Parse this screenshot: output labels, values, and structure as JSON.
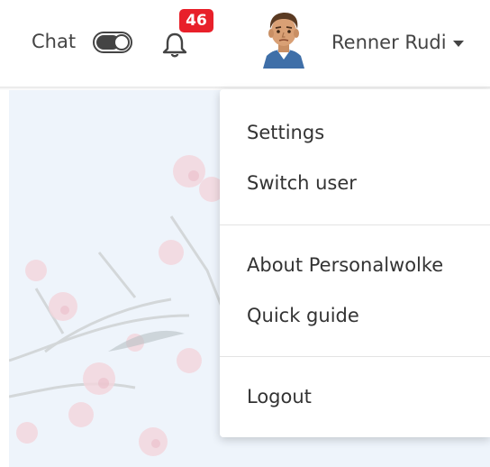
{
  "header": {
    "chat_label": "Chat",
    "chat_enabled": true,
    "notifications_count": "46",
    "user_name": "Renner Rudi"
  },
  "icons": {
    "chat_toggle": "toggle-icon",
    "notifications": "bell-icon",
    "user_menu": "caret-down-icon"
  },
  "colors": {
    "badge": "#e8202a",
    "text": "#444444",
    "content_bg": "#eef4fb"
  },
  "dropdown": {
    "items": [
      {
        "label": "Settings"
      },
      {
        "label": "Switch user"
      },
      {
        "label": "About Personalwolke"
      },
      {
        "label": "Quick guide"
      },
      {
        "label": "Logout"
      }
    ]
  }
}
